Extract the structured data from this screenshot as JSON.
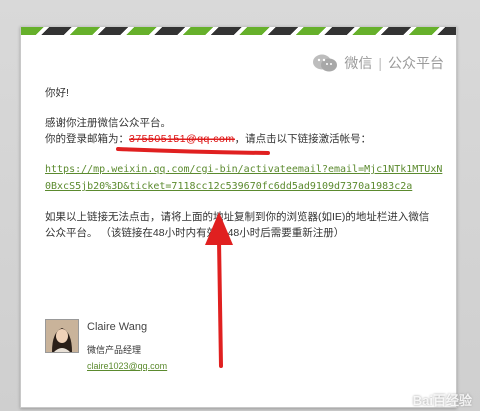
{
  "brand": {
    "wechat": "微信",
    "platform": "公众平台"
  },
  "email": {
    "greeting": "你好!",
    "thanks": "感谢你注册微信公众平台。",
    "login_label": "你的登录邮箱为：",
    "login_email_redacted": "375505151@qq.com",
    "login_suffix": "，请点击以下链接激活帐号：",
    "activation_link": "https://mp.weixin.qq.com/cgi-bin/activateemail?email=Mjc1NTk1MTUxN0BxcS5jb20%3D&ticket=7118cc12c539670fc6dd5ad9109d7370a1983c2a",
    "note_line1": "如果以上链接无法点击，请将上面的地址复制到你的浏览器(如IE)的地址栏进入微信",
    "note_line2": "公众平台。 （该链接在48小时内有效，48小时后需要重新注册）"
  },
  "signature": {
    "name": "Claire Wang",
    "title": "微信产品经理",
    "email": "claire1023@qq.com"
  },
  "watermark": {
    "text": "Bai百经验"
  },
  "colors": {
    "accent_green": "#66b02b",
    "link_green": "#5b8a2e",
    "annotation_red": "#e02020"
  }
}
